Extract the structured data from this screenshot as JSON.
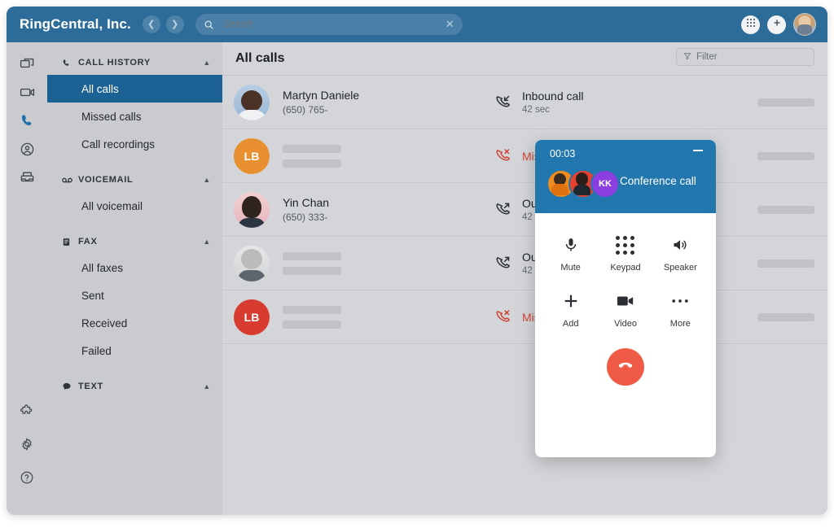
{
  "topbar": {
    "brand": "RingCentral, Inc.",
    "back_icon": "chevron-left-icon",
    "forward_icon": "chevron-right-icon",
    "search_icon": "search-icon",
    "search_value": "",
    "search_placeholder": "Search",
    "clear_icon": "close-icon",
    "dialpad_icon": "dialpad-icon",
    "add_icon": "plus-icon",
    "avatar": "user-avatar"
  },
  "rail": {
    "items": [
      {
        "icon": "message-icon",
        "name": "rail-item-message",
        "active": false
      },
      {
        "icon": "video-icon",
        "name": "rail-item-video",
        "active": false
      },
      {
        "icon": "phone-icon",
        "name": "rail-item-phone",
        "active": true
      },
      {
        "icon": "contacts-icon",
        "name": "rail-item-contacts",
        "active": false
      },
      {
        "icon": "fax-inbox-icon",
        "name": "rail-item-fax",
        "active": false
      }
    ],
    "bottom": [
      {
        "icon": "puzzle-icon",
        "name": "rail-item-apps"
      },
      {
        "icon": "gear-icon",
        "name": "rail-item-settings"
      },
      {
        "icon": "help-icon",
        "name": "rail-item-help"
      }
    ]
  },
  "sidebar": {
    "groups": [
      {
        "title": "CALL HISTORY",
        "icon": "phone-icon",
        "chevron": "chevron-up-icon",
        "items": [
          {
            "label": "All calls",
            "selected": true
          },
          {
            "label": "Missed calls",
            "selected": false
          },
          {
            "label": "Call recordings",
            "selected": false
          }
        ]
      },
      {
        "title": "VOICEMAIL",
        "icon": "voicemail-icon",
        "chevron": "chevron-up-icon",
        "items": [
          {
            "label": "All voicemail",
            "selected": false
          }
        ]
      },
      {
        "title": "FAX",
        "icon": "fax-icon",
        "chevron": "chevron-up-icon",
        "items": [
          {
            "label": "All faxes",
            "selected": false
          },
          {
            "label": "Sent",
            "selected": false
          },
          {
            "label": "Received",
            "selected": false
          },
          {
            "label": "Failed",
            "selected": false
          }
        ]
      },
      {
        "title": "TEXT",
        "icon": "chat-icon",
        "chevron": "chevron-up-icon",
        "items": []
      }
    ]
  },
  "content": {
    "title": "All calls",
    "filter": {
      "icon": "filter-icon",
      "label": "Filter"
    },
    "rows": [
      {
        "avatar_kind": "photo-a",
        "avatar_initials": "",
        "name": "Martyn Daniele",
        "phone": "(650) 765-",
        "redacted": false,
        "type_label": "Inbound call",
        "type_icon": "phone-inbound-icon",
        "duration": "42 sec",
        "missed": false
      },
      {
        "avatar_kind": "initials-orange",
        "avatar_initials": "LB",
        "name": "",
        "phone": "",
        "redacted": true,
        "type_label": "Missed call",
        "type_icon": "phone-missed-icon",
        "duration": "",
        "missed": true
      },
      {
        "avatar_kind": "photo-c",
        "avatar_initials": "",
        "name": "Yin Chan",
        "phone": "(650) 333-",
        "redacted": false,
        "type_label": "Outbound call",
        "type_icon": "phone-outbound-icon",
        "duration": "42 sec",
        "missed": false
      },
      {
        "avatar_kind": "photo-d",
        "avatar_initials": "",
        "name": "",
        "phone": "",
        "redacted": true,
        "type_label": "Outbound call",
        "type_icon": "phone-outbound-icon",
        "duration": "42 sec",
        "missed": false
      },
      {
        "avatar_kind": "initials-red",
        "avatar_initials": "LB",
        "name": "",
        "phone": "",
        "redacted": true,
        "type_label": "Missed call",
        "type_icon": "phone-missed-icon",
        "duration": "",
        "missed": true
      }
    ]
  },
  "call_popup": {
    "timer": "00:03",
    "minimize_icon": "minimize-icon",
    "title": "Conference call",
    "participants": [
      {
        "kind": "photo-orange",
        "initials": ""
      },
      {
        "kind": "photo-red",
        "initials": ""
      },
      {
        "kind": "initials-purple",
        "initials": "KK"
      }
    ],
    "controls": [
      {
        "label": "Mute",
        "icon": "microphone-icon",
        "name": "mute-button"
      },
      {
        "label": "Keypad",
        "icon": "dialpad-icon",
        "name": "keypad-button"
      },
      {
        "label": "Speaker",
        "icon": "speaker-icon",
        "name": "speaker-button"
      },
      {
        "label": "Add",
        "icon": "plus-icon",
        "name": "add-button"
      },
      {
        "label": "Video",
        "icon": "video-camera-icon",
        "name": "video-button"
      },
      {
        "label": "More",
        "icon": "ellipsis-icon",
        "name": "more-button"
      }
    ],
    "hangup_icon": "phone-hangup-icon"
  },
  "colors": {
    "topbar": "#2d6c99",
    "selected_nav": "#1c6193",
    "popup_header": "#2277ae",
    "missed_red": "#cf4436",
    "hangup_red": "#ef5a46",
    "purple_avatar": "#8b3fe0"
  }
}
